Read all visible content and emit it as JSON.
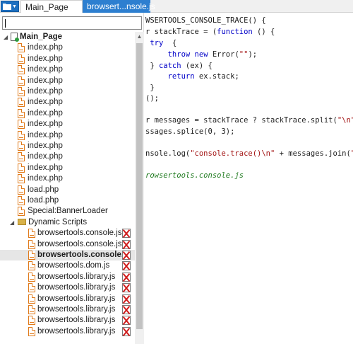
{
  "tabs": [
    {
      "label": "Main_Page",
      "active": false
    },
    {
      "label": "browsert...nsole.js",
      "active": true
    }
  ],
  "search": {
    "value": "",
    "placeholder": ""
  },
  "tree": {
    "root": "Main_Page",
    "pages": [
      "index.php",
      "index.php",
      "index.php",
      "index.php",
      "index.php",
      "index.php",
      "index.php",
      "index.php",
      "index.php",
      "index.php",
      "index.php",
      "index.php",
      "index.php",
      "load.php",
      "load.php",
      "Special:BannerLoader"
    ],
    "folder": "Dynamic Scripts",
    "scripts": [
      "browsertools.console.js",
      "browsertools.console.js",
      "browsertools.console.js",
      "browsertools.dom.js",
      "browsertools.library.js",
      "browsertools.library.js",
      "browsertools.library.js",
      "browsertools.library.js",
      "browsertools.library.js",
      "browsertools.library.js"
    ],
    "selected_script_index": 2
  },
  "code_lines": [
    [
      {
        "t": "WSERTOOLS_CONSOLE_TRACE() {",
        "c": ""
      }
    ],
    [
      {
        "t": "r stackTrace = (",
        "c": ""
      },
      {
        "t": "function",
        "c": "kw"
      },
      {
        "t": " () {",
        "c": ""
      }
    ],
    [
      {
        "t": " ",
        "c": ""
      },
      {
        "t": "try",
        "c": "kw"
      },
      {
        "t": "  {",
        "c": ""
      }
    ],
    [
      {
        "t": "     ",
        "c": ""
      },
      {
        "t": "throw",
        "c": "kw"
      },
      {
        "t": " ",
        "c": ""
      },
      {
        "t": "new",
        "c": "kw"
      },
      {
        "t": " Error(",
        "c": ""
      },
      {
        "t": "\"\"",
        "c": "str"
      },
      {
        "t": ");",
        "c": ""
      }
    ],
    [
      {
        "t": " } ",
        "c": ""
      },
      {
        "t": "catch",
        "c": "kw"
      },
      {
        "t": " (ex) {",
        "c": ""
      }
    ],
    [
      {
        "t": "     ",
        "c": ""
      },
      {
        "t": "return",
        "c": "kw"
      },
      {
        "t": " ex.stack;",
        "c": ""
      }
    ],
    [
      {
        "t": " }",
        "c": ""
      }
    ],
    [
      {
        "t": "();",
        "c": ""
      }
    ],
    [
      {
        "t": "",
        "c": ""
      }
    ],
    [
      {
        "t": "r messages = stackTrace ? stackTrace.split(",
        "c": ""
      },
      {
        "t": "\"\\n\"",
        "c": "str"
      },
      {
        "t": ") : ",
        "c": ""
      },
      {
        "t": "\"\"",
        "c": "str"
      },
      {
        "t": ";",
        "c": ""
      }
    ],
    [
      {
        "t": "ssages.splice(0, 3);",
        "c": ""
      }
    ],
    [
      {
        "t": "",
        "c": ""
      }
    ],
    [
      {
        "t": "nsole.log(",
        "c": ""
      },
      {
        "t": "\"console.trace()\\n\"",
        "c": "str"
      },
      {
        "t": " + messages.join(",
        "c": ""
      },
      {
        "t": "\"\\n\"",
        "c": "str"
      },
      {
        "t": "));",
        "c": ""
      }
    ],
    [
      {
        "t": "",
        "c": ""
      }
    ],
    [
      {
        "t": "rowsertools.console.js",
        "c": "cm"
      }
    ]
  ],
  "icons": {
    "folder_button": "folder-icon",
    "file": "file-icon",
    "disabled_script": "x-mark-icon"
  },
  "colors": {
    "accent": "#2d7fd0",
    "file_icon": "#e07a1a",
    "keyword": "#0000c8",
    "string": "#a31515",
    "comment": "#1f7a1f"
  }
}
